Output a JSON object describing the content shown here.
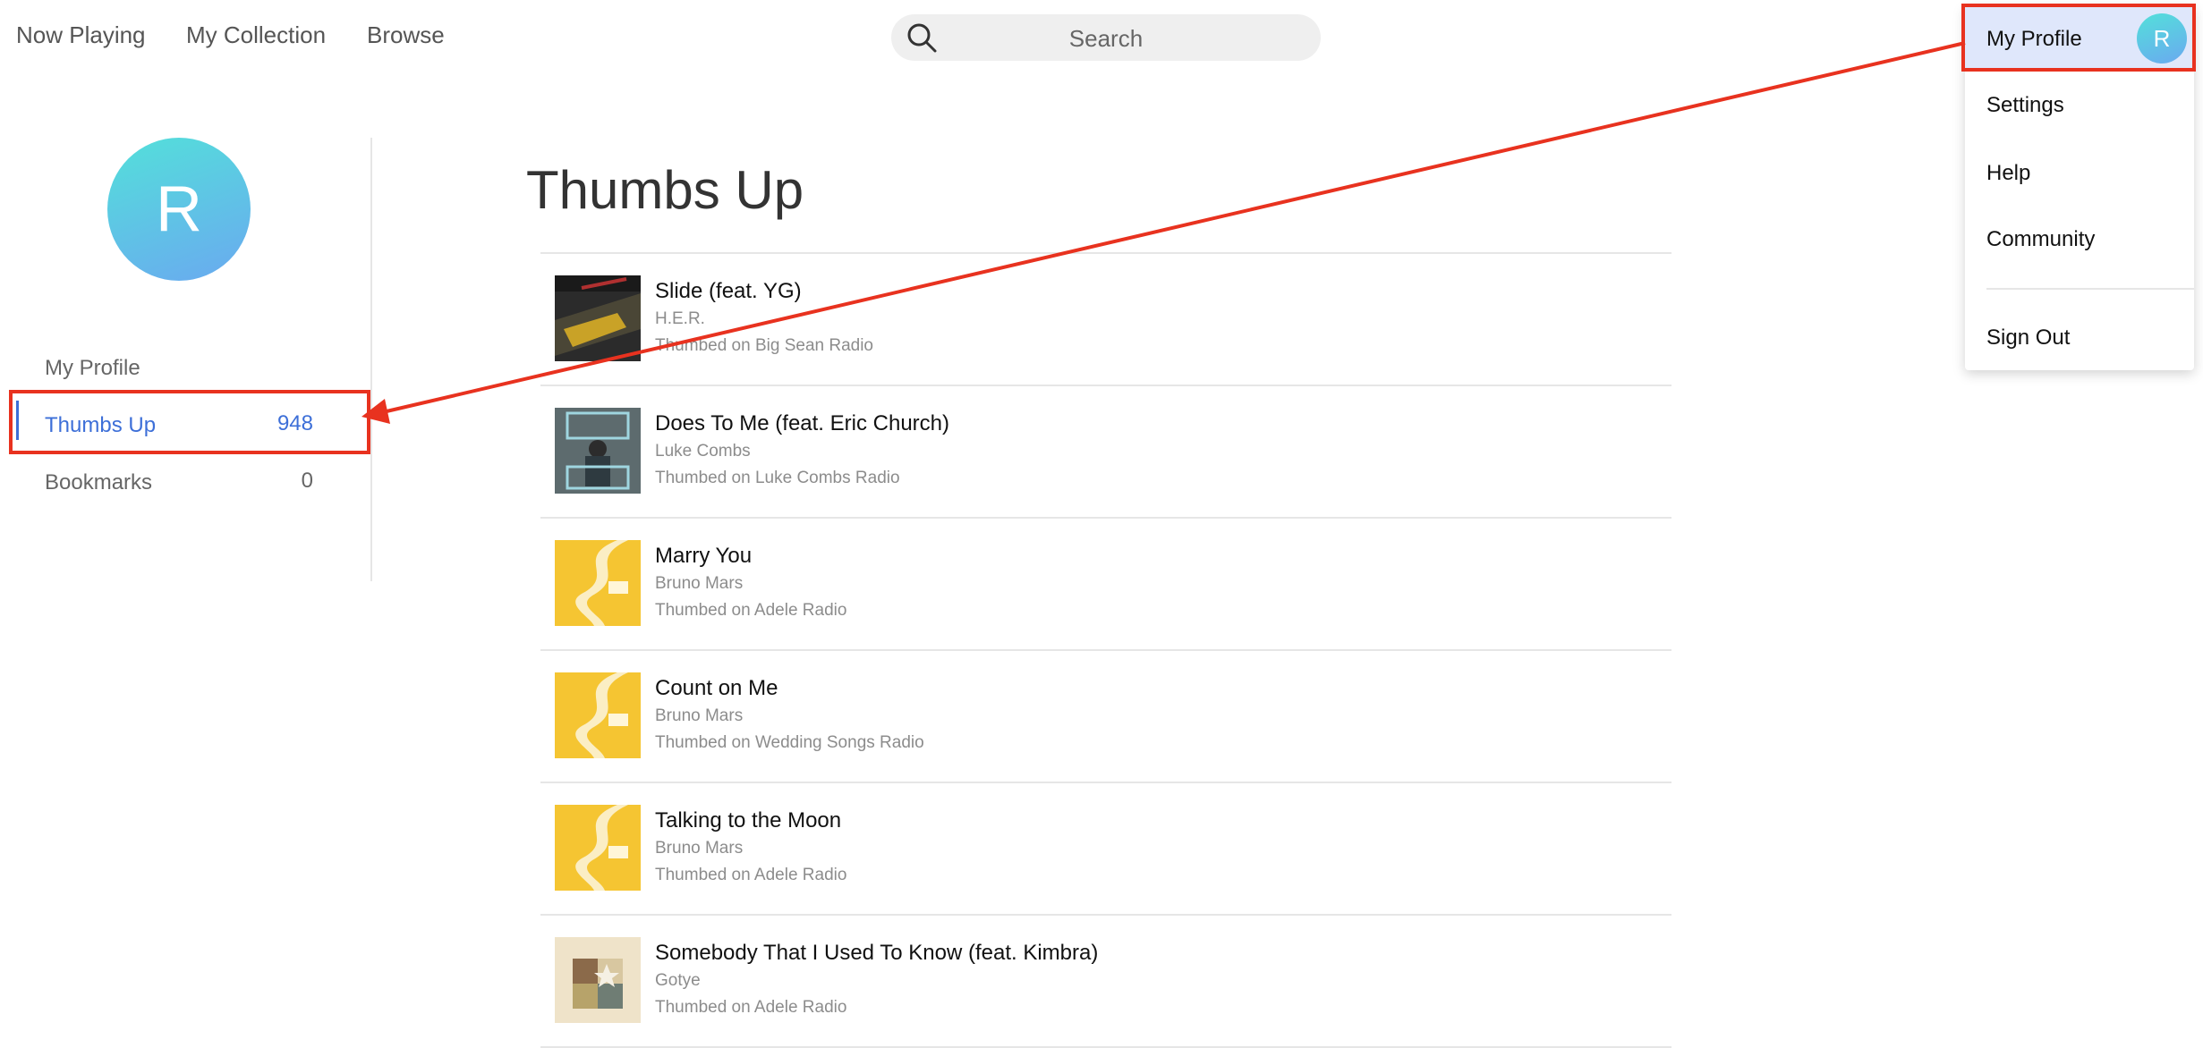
{
  "nav": {
    "items": [
      "Now Playing",
      "My Collection",
      "Browse"
    ],
    "search_placeholder": "Search"
  },
  "profile": {
    "initial": "R"
  },
  "sidebar": {
    "items": [
      {
        "label": "My Profile",
        "count": ""
      },
      {
        "label": "Thumbs Up",
        "count": "948"
      },
      {
        "label": "Bookmarks",
        "count": "0"
      }
    ]
  },
  "main": {
    "title": "Thumbs Up",
    "tracks": [
      {
        "title": "Slide (feat. YG)",
        "artist": "H.E.R.",
        "source": "Thumbed on Big Sean Radio",
        "art": "dark-car-art"
      },
      {
        "title": "Does To Me (feat. Eric Church)",
        "artist": "Luke Combs",
        "source": "Thumbed on Luke Combs Radio",
        "art": "luke-combs-art"
      },
      {
        "title": "Marry You",
        "artist": "Bruno Mars",
        "source": "Thumbed on Adele Radio",
        "art": "yellow-road-art"
      },
      {
        "title": "Count on Me",
        "artist": "Bruno Mars",
        "source": "Thumbed on Wedding Songs Radio",
        "art": "yellow-road-art"
      },
      {
        "title": "Talking to the Moon",
        "artist": "Bruno Mars",
        "source": "Thumbed on Adele Radio",
        "art": "yellow-road-art"
      },
      {
        "title": "Somebody That I Used To Know (feat. Kimbra)",
        "artist": "Gotye",
        "source": "Thumbed on Adele Radio",
        "art": "gotye-art"
      }
    ]
  },
  "dropdown": {
    "items": [
      "My Profile",
      "Settings",
      "Help",
      "Community",
      "Sign Out"
    ]
  },
  "colors": {
    "accent": "#3d6fd8",
    "annotation": "#e8321f",
    "highlight": "#dfe7fb"
  }
}
